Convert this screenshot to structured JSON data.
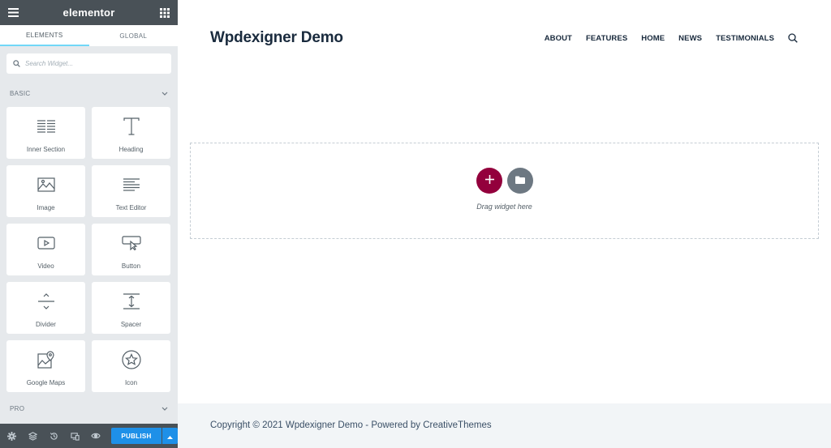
{
  "editor": {
    "logo_text": "elementor",
    "tabs": [
      {
        "label": "ELEMENTS"
      },
      {
        "label": "GLOBAL"
      }
    ],
    "search": {
      "placeholder": "Search Widget..."
    },
    "sections": {
      "basic": "BASIC",
      "pro": "PRO"
    },
    "widgets": [
      {
        "label": "Inner Section",
        "icon": "inner-section-icon"
      },
      {
        "label": "Heading",
        "icon": "heading-icon"
      },
      {
        "label": "Image",
        "icon": "image-icon"
      },
      {
        "label": "Text Editor",
        "icon": "text-editor-icon"
      },
      {
        "label": "Video",
        "icon": "video-icon"
      },
      {
        "label": "Button",
        "icon": "button-icon"
      },
      {
        "label": "Divider",
        "icon": "divider-icon"
      },
      {
        "label": "Spacer",
        "icon": "spacer-icon"
      },
      {
        "label": "Google Maps",
        "icon": "google-maps-icon"
      },
      {
        "label": "Icon",
        "icon": "star-icon"
      }
    ],
    "footer": {
      "publish_label": "PUBLISH"
    },
    "colors": {
      "panel_dark": "#495157",
      "panel_bg": "#e6e9ec",
      "publish_blue": "#1e90e8",
      "add_button": "#93003c",
      "template_button": "#6d7882"
    }
  },
  "site": {
    "title": "Wpdexigner Demo",
    "nav": [
      {
        "label": "ABOUT"
      },
      {
        "label": "FEATURES"
      },
      {
        "label": "HOME"
      },
      {
        "label": "NEWS"
      },
      {
        "label": "TESTIMONIALS"
      }
    ],
    "dropzone_text": "Drag widget here",
    "copyright": "Copyright © 2021 Wpdexigner Demo - Powered by CreativeThemes"
  }
}
